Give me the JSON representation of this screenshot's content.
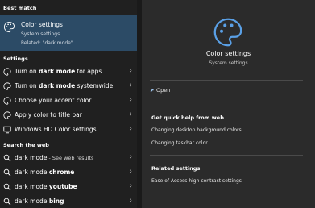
{
  "left": {
    "best_match_title": "Best match",
    "best": {
      "title": "Color settings",
      "subtitle": "System settings",
      "related": "Related: \"dark mode\""
    },
    "settings_title": "Settings",
    "settings": [
      {
        "pre": "Turn on ",
        "bold": "dark mode",
        "post": " for apps",
        "icon": "paint-icon"
      },
      {
        "pre": "Turn on ",
        "bold": "dark mode",
        "post": " systemwide",
        "icon": "paint-icon"
      },
      {
        "pre": "Choose your accent color",
        "bold": "",
        "post": "",
        "icon": "paint-icon"
      },
      {
        "pre": "Apply color to title bar",
        "bold": "",
        "post": "",
        "icon": "paint-icon"
      },
      {
        "pre": "Windows HD Color settings",
        "bold": "",
        "post": "",
        "icon": "monitor-icon"
      }
    ],
    "web_title": "Search the web",
    "web": [
      {
        "pre": "dark mode",
        "post": " - See web results"
      },
      {
        "pre": "dark mode ",
        "post": "chrome"
      },
      {
        "pre": "dark mode ",
        "post": "youtube"
      },
      {
        "pre": "dark mode ",
        "post": "bing"
      }
    ]
  },
  "right": {
    "title": "Color settings",
    "subtitle": "System settings",
    "open_label": "Open",
    "help_heading": "Get quick help from web",
    "help_links": [
      "Changing desktop background colors",
      "Changing taskbar color"
    ],
    "related_heading": "Related settings",
    "related_links": [
      "Ease of Access high contrast settings"
    ]
  }
}
